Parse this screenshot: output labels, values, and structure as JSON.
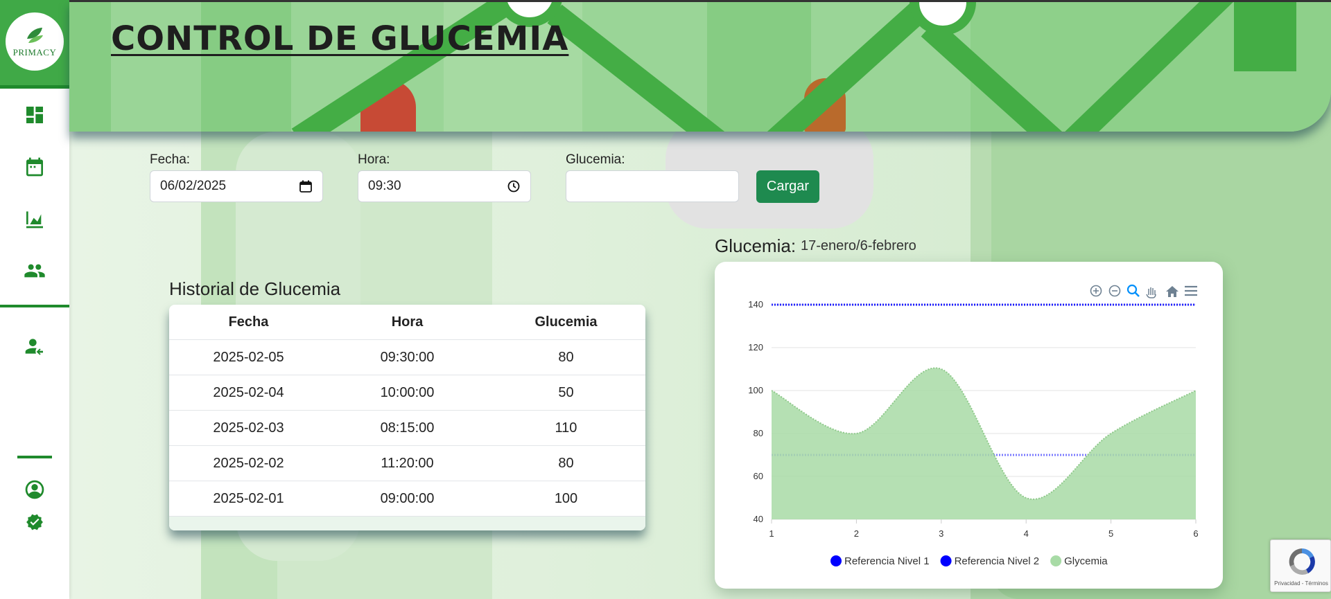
{
  "app": {
    "brand": "PRIMACY",
    "title": "CONTROL DE GLUCEMIA"
  },
  "sidebar": {
    "items": [
      {
        "name": "dashboard",
        "icon": "dashboard-icon"
      },
      {
        "name": "calendar",
        "icon": "calendar-icon"
      },
      {
        "name": "chart",
        "icon": "area-chart-icon"
      },
      {
        "name": "users",
        "icon": "group-icon"
      },
      {
        "name": "logout",
        "icon": "person-exit-icon"
      },
      {
        "name": "account",
        "icon": "account-circle-icon"
      },
      {
        "name": "verified",
        "icon": "verified-badge-icon"
      }
    ],
    "accent": "#1f8a2c"
  },
  "form": {
    "fecha_label": "Fecha:",
    "fecha_value": "06/02/2025",
    "hora_label": "Hora:",
    "hora_value": "09:30",
    "glucemia_label": "Glucemia:",
    "glucemia_value": "",
    "submit_label": "Cargar"
  },
  "history": {
    "title": "Historial de Glucemia",
    "columns": [
      "Fecha",
      "Hora",
      "Glucemia"
    ],
    "rows": [
      [
        "2025-02-05",
        "09:30:00",
        "80"
      ],
      [
        "2025-02-04",
        "10:00:00",
        "50"
      ],
      [
        "2025-02-03",
        "08:15:00",
        "110"
      ],
      [
        "2025-02-02",
        "11:20:00",
        "80"
      ],
      [
        "2025-02-01",
        "09:00:00",
        "100"
      ]
    ]
  },
  "chart_heading": {
    "label": "Glucemia:",
    "range": "17-enero/6-febrero"
  },
  "chart_data": {
    "type": "area",
    "x": [
      1,
      2,
      3,
      4,
      5,
      6
    ],
    "ylim": [
      40,
      140
    ],
    "yticks": [
      40,
      60,
      80,
      100,
      120,
      140
    ],
    "grid": true,
    "legend_position": "bottom",
    "series": [
      {
        "name": "Referencia Nivel 1",
        "type": "line",
        "values": [
          140,
          140,
          140,
          140,
          140,
          140
        ],
        "color": "#1a1aff"
      },
      {
        "name": "Referencia Nivel 2",
        "type": "line",
        "values": [
          70,
          70,
          70,
          70,
          70,
          70
        ],
        "color": "#7b7bff"
      },
      {
        "name": "Glycemia",
        "type": "area",
        "values": [
          100,
          80,
          110,
          50,
          80,
          100
        ],
        "color": "#a8dba6"
      }
    ],
    "toolbar": [
      "zoom-in-icon",
      "zoom-out-icon",
      "zoom-select-icon",
      "pan-icon",
      "home-icon",
      "menu-icon"
    ]
  },
  "recaptcha": {
    "text": "Privacidad - Términos"
  }
}
